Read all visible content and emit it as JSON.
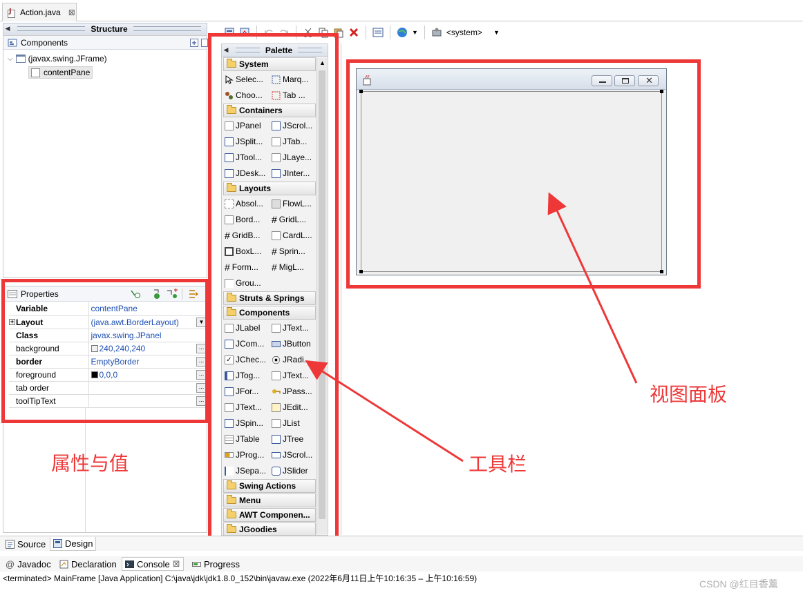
{
  "editor": {
    "tab_label": "Action.java",
    "tab_close": "⊠"
  },
  "structure": {
    "header": "Structure",
    "components_title": "Components",
    "tree": [
      {
        "label": "(javax.swing.JFrame)"
      },
      {
        "label": "contentPane"
      }
    ]
  },
  "properties": {
    "title": "Properties",
    "rows": [
      {
        "name": "Variable",
        "value": "contentPane"
      },
      {
        "name": "Layout",
        "value": "(java.awt.BorderLayout)"
      },
      {
        "name": "Class",
        "value": "javax.swing.JPanel"
      },
      {
        "name": "background",
        "value": "240,240,240"
      },
      {
        "name": "border",
        "value": "EmptyBorder"
      },
      {
        "name": "foreground",
        "value": "0,0,0"
      },
      {
        "name": "tab order",
        "value": ""
      },
      {
        "name": "toolTipText",
        "value": ""
      }
    ],
    "background_swatch": "#f0f0f0",
    "foreground_swatch": "#000000"
  },
  "palette": {
    "header": "Palette",
    "categories": {
      "system": "System",
      "containers": "Containers",
      "layouts": "Layouts",
      "struts": "Struts & Springs",
      "components": "Components",
      "swing_actions": "Swing Actions",
      "menu": "Menu",
      "awt": "AWT Componen...",
      "jgoodies": "JGoodies"
    },
    "items": [
      "Selec...",
      "Marq...",
      "Choo...",
      "Tab ...",
      "JPanel",
      "JScrol...",
      "JSplit...",
      "JTab...",
      "JTool...",
      "JLaye...",
      "JDesk...",
      "JInter...",
      "Absol...",
      "FlowL...",
      "Bord...",
      "GridL...",
      "GridB...",
      "CardL...",
      "BoxL...",
      "Sprin...",
      "Form...",
      "MigL...",
      "Grou...",
      "JLabel",
      "JText...",
      "JCom...",
      "JButton",
      "JChec...",
      "JRadi...",
      "JTog...",
      "JText...",
      "JFor...",
      "JPass...",
      "JText...",
      "JEdit...",
      "JSpin...",
      "JList",
      "JTable",
      "JTree",
      "JProg...",
      "JScrol...",
      "JSepa...",
      "JSlider"
    ]
  },
  "toolbar": {
    "system_label": "<system>"
  },
  "annotations": {
    "view_panel": "视图面板",
    "toolbar": "工具栏",
    "properties": "属性与值"
  },
  "bottom": {
    "source_tab": "Source",
    "design_tab": "Design",
    "javadoc_tab": "Javadoc",
    "declaration_tab": "Declaration",
    "console_tab": "Console",
    "progress_tab": "Progress",
    "status": "<terminated> MainFrame [Java Application] C:\\java\\jdk\\jdk1.8.0_152\\bin\\javaw.exe  (2022年6月11日上午10:16:35 – 上午10:16:59)",
    "watermark": "CSDN @红目香薰"
  },
  "colors": {
    "annotation_red": "#ee3838",
    "value_blue": "#1d4fb3"
  }
}
